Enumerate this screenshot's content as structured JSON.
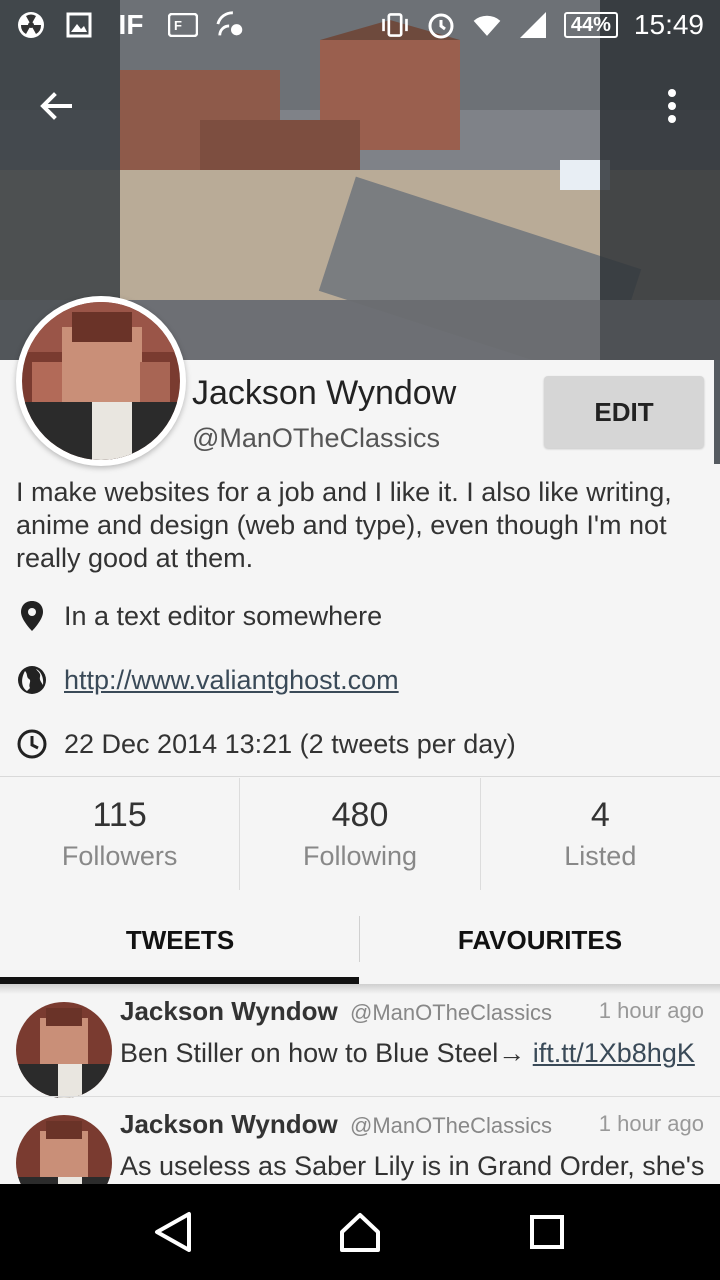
{
  "status_bar": {
    "time": "15:49",
    "battery": "44%",
    "icons": [
      "radiation-icon",
      "image-icon",
      "if-icon",
      "feedly-icon",
      "cast-icon",
      "vibrate-icon",
      "alarm-icon",
      "wifi-icon",
      "signal-icon"
    ]
  },
  "toolbar": {
    "back_icon": "arrow-left-icon",
    "overflow_icon": "more-vert-icon"
  },
  "profile": {
    "name": "Jackson Wyndow",
    "handle": "@ManOTheClassics",
    "edit_label": "EDIT",
    "bio": "I make websites for a job and I like it. I also like writing, anime and design (web and type), even though I'm not really good at them.",
    "location": "In a text editor somewhere",
    "website": "http://www.valiantghost.com",
    "joined": "22 Dec 2014 13:21 (2 tweets per day)"
  },
  "stats": [
    {
      "value": "115",
      "label": "Followers"
    },
    {
      "value": "480",
      "label": "Following"
    },
    {
      "value": "4",
      "label": "Listed"
    }
  ],
  "tabs": [
    {
      "label": "TWEETS",
      "active": true
    },
    {
      "label": "FAVOURITES",
      "active": false
    }
  ],
  "tweets": [
    {
      "name": "Jackson Wyndow",
      "handle": "@ManOTheClassics",
      "time": "1 hour ago",
      "text": "Ben Stiller on how to Blue Steel→ ",
      "link": "ift.tt/1Xb8hgK"
    },
    {
      "name": "Jackson Wyndow",
      "handle": "@ManOTheClassics",
      "time": "1 hour ago",
      "text": "As useless as Saber Lily is in Grand Order, she's",
      "link": ""
    }
  ],
  "nav": {
    "back": "nav-back-icon",
    "home": "nav-home-icon",
    "recents": "nav-recents-icon"
  }
}
